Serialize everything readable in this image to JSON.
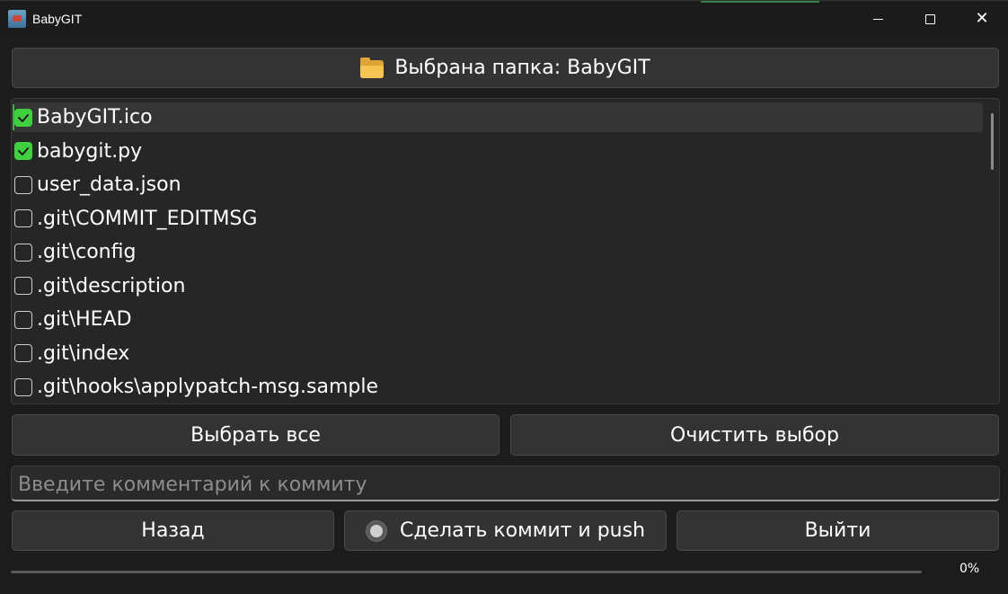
{
  "window": {
    "title": "BabyGIT"
  },
  "folder_button": {
    "label": "Выбрана папка: BabyGIT",
    "icon": "folder-icon"
  },
  "files": [
    {
      "name": "BabyGIT.ico",
      "checked": true,
      "selected": true
    },
    {
      "name": "babygit.py",
      "checked": true,
      "selected": false
    },
    {
      "name": "user_data.json",
      "checked": false,
      "selected": false
    },
    {
      "name": ".git\\COMMIT_EDITMSG",
      "checked": false,
      "selected": false
    },
    {
      "name": ".git\\config",
      "checked": false,
      "selected": false
    },
    {
      "name": ".git\\description",
      "checked": false,
      "selected": false
    },
    {
      "name": ".git\\HEAD",
      "checked": false,
      "selected": false
    },
    {
      "name": ".git\\index",
      "checked": false,
      "selected": false
    },
    {
      "name": ".git\\hooks\\applypatch-msg.sample",
      "checked": false,
      "selected": false
    }
  ],
  "actions": {
    "select_all": "Выбрать все",
    "clear_selection": "Очистить выбор"
  },
  "comment": {
    "placeholder": "Введите комментарий к коммиту",
    "value": ""
  },
  "bottom": {
    "back": "Назад",
    "commit_push": "Сделать коммит и push",
    "exit": "Выйти"
  },
  "progress": {
    "value": 0,
    "label": "0%"
  },
  "colors": {
    "check_green": "#3fcf3f",
    "folder_yellow": "#f6c452",
    "background": "#1c1c1c"
  }
}
